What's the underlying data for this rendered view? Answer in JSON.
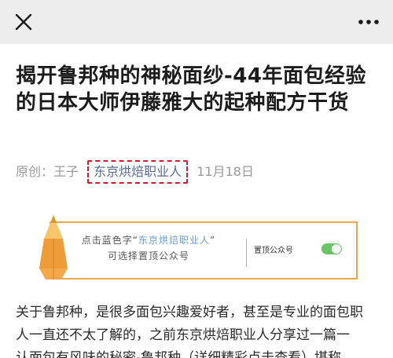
{
  "colors": {
    "topbar_bg": "#ededed",
    "link_blue": "#576b95",
    "highlight_red": "#d21f2f",
    "promo_orange": "#f0a843",
    "toggle_green": "#6cc468"
  },
  "icons": {
    "close": "close-icon",
    "more": "more-dots-icon",
    "pencil": "pencil-icon"
  },
  "article": {
    "title": "揭开鲁邦种的神秘面纱-44年面包经验的日本大师伊藤雅大的起种配方干货",
    "meta": {
      "prefix": "原创：王子",
      "account": "东京烘焙职业人",
      "date": "11月18日"
    }
  },
  "promo": {
    "line1_pre": "点击蓝色字“",
    "line1_link": "东京烘焙职业人",
    "line1_post": "”",
    "line2": "可选择置顶公众号",
    "setting_label": "置顶公众号",
    "toggle_on": true
  },
  "body": {
    "line1": "关于鲁邦种，是很多面包兴趣爱好者，甚至是专业的面包职",
    "line2": "人一直还不太了解的，之前东京烘焙职业人分享过一篇一",
    "line3": "认面包有风味的秘密-鲁邦种（详细精彩点击查看）堪称"
  }
}
